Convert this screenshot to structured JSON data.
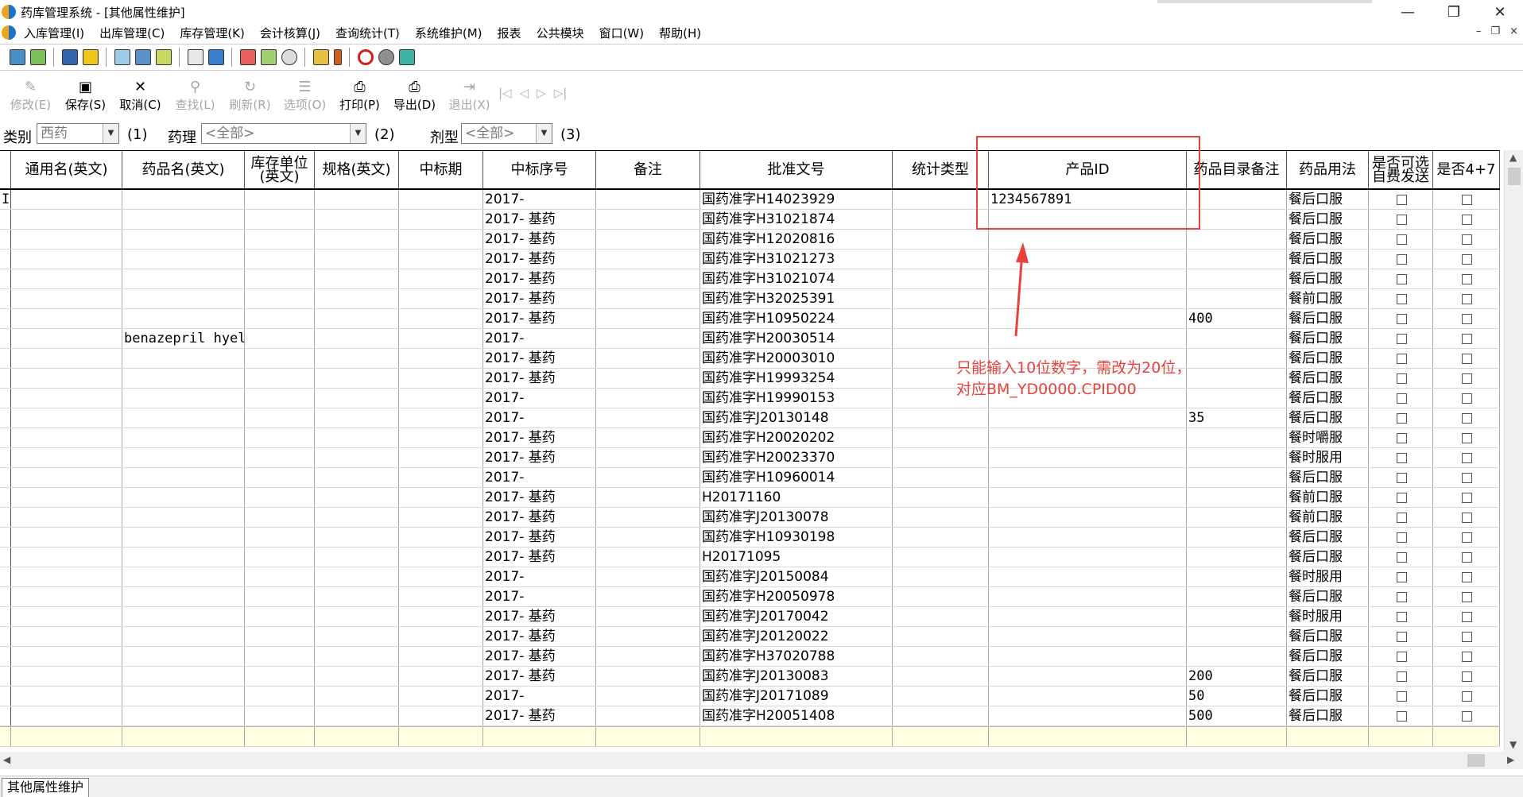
{
  "titlebar": {
    "title": "药库管理系统 - [其他属性维护]",
    "minimize": "—",
    "restore": "❐",
    "close": "✕"
  },
  "menu": {
    "items": [
      "入库管理(I)",
      "出库管理(C)",
      "库存管理(K)",
      "会计核算(J)",
      "查询统计(T)",
      "系统维护(M)",
      "报表",
      "公共模块",
      "窗口(W)",
      "帮助(H)"
    ],
    "mdi": [
      "–",
      "❐",
      "×"
    ]
  },
  "actions": [
    {
      "label": "修改(E)",
      "icon": "✎",
      "enabled": false
    },
    {
      "label": "保存(S)",
      "icon": "▣",
      "enabled": true
    },
    {
      "label": "取消(C)",
      "icon": "✕",
      "enabled": true
    },
    {
      "label": "查找(L)",
      "icon": "⚲",
      "enabled": false
    },
    {
      "label": "刷新(R)",
      "icon": "↻",
      "enabled": false
    },
    {
      "label": "选项(O)",
      "icon": "☰",
      "enabled": false
    },
    {
      "label": "打印(P)",
      "icon": "⎙",
      "enabled": true
    },
    {
      "label": "导出(D)",
      "icon": "⎙",
      "enabled": true
    },
    {
      "label": "退出(X)",
      "icon": "⇥",
      "enabled": false
    }
  ],
  "nav_arrows": [
    "|◁",
    "◁",
    "▷",
    "▷|"
  ],
  "filters": {
    "category_label": "类别",
    "category_value": "西药",
    "category_hint": "(1)",
    "pharm_label": "药理",
    "pharm_value": "<全部>",
    "pharm_hint": "(2)",
    "form_label": "剂型",
    "form_value": "<全部>",
    "form_hint": "(3)"
  },
  "grid": {
    "columns": [
      "通用名(英文)",
      "药品名(英文)",
      "库存单位\n(英文)",
      "规格(英文)",
      "中标期",
      "中标序号",
      "备注",
      "批准文号",
      "统计类型",
      "产品ID",
      "药品目录备注",
      "药品用法",
      "是否可选\n自费发送",
      "是否4+7"
    ],
    "rows": [
      {
        "drug_en": "",
        "bid_no": "2017-",
        "approval": "国药准字H14023929",
        "product_id": "1234567891",
        "catalog_note": "",
        "usage": "餐后口服"
      },
      {
        "drug_en": "",
        "bid_no": "2017- 基药",
        "approval": "国药准字H31021874",
        "product_id": "",
        "catalog_note": "",
        "usage": "餐后口服"
      },
      {
        "drug_en": "",
        "bid_no": "2017- 基药",
        "approval": "国药准字H12020816",
        "product_id": "",
        "catalog_note": "",
        "usage": "餐后口服"
      },
      {
        "drug_en": "",
        "bid_no": "2017- 基药",
        "approval": "国药准字H31021273",
        "product_id": "",
        "catalog_note": "",
        "usage": "餐后口服"
      },
      {
        "drug_en": "",
        "bid_no": "2017- 基药",
        "approval": "国药准字H31021074",
        "product_id": "",
        "catalog_note": "",
        "usage": "餐后口服"
      },
      {
        "drug_en": "",
        "bid_no": "2017- 基药",
        "approval": "国药准字H32025391",
        "product_id": "",
        "catalog_note": "",
        "usage": "餐前口服"
      },
      {
        "drug_en": "",
        "bid_no": "2017- 基药",
        "approval": "国药准字H10950224",
        "product_id": "",
        "catalog_note": "400",
        "usage": "餐后口服"
      },
      {
        "drug_en": "benazepril hyel",
        "bid_no": "2017-",
        "approval": "国药准字H20030514",
        "product_id": "",
        "catalog_note": "",
        "usage": "餐后口服"
      },
      {
        "drug_en": "",
        "bid_no": "2017- 基药",
        "approval": "国药准字H20003010",
        "product_id": "",
        "catalog_note": "",
        "usage": "餐后口服"
      },
      {
        "drug_en": "",
        "bid_no": "2017- 基药",
        "approval": "国药准字H19993254",
        "product_id": "",
        "catalog_note": "",
        "usage": "餐后口服"
      },
      {
        "drug_en": "",
        "bid_no": "2017-",
        "approval": "国药准字H19990153",
        "product_id": "",
        "catalog_note": "",
        "usage": "餐后口服"
      },
      {
        "drug_en": "",
        "bid_no": "2017-",
        "approval": "国药准字J20130148",
        "product_id": "",
        "catalog_note": "35",
        "usage": "餐后口服"
      },
      {
        "drug_en": "",
        "bid_no": "2017- 基药",
        "approval": "国药准字H20020202",
        "product_id": "",
        "catalog_note": "",
        "usage": "餐时嚼服"
      },
      {
        "drug_en": "",
        "bid_no": "2017- 基药",
        "approval": "国药准字H20023370",
        "product_id": "",
        "catalog_note": "",
        "usage": "餐时服用"
      },
      {
        "drug_en": "",
        "bid_no": "2017-",
        "approval": "国药准字H10960014",
        "product_id": "",
        "catalog_note": "",
        "usage": "餐后口服"
      },
      {
        "drug_en": "",
        "bid_no": "2017- 基药",
        "approval": "H20171160",
        "product_id": "",
        "catalog_note": "",
        "usage": "餐前口服"
      },
      {
        "drug_en": "",
        "bid_no": "2017- 基药",
        "approval": "国药准字J20130078",
        "product_id": "",
        "catalog_note": "",
        "usage": "餐前口服"
      },
      {
        "drug_en": "",
        "bid_no": "2017- 基药",
        "approval": "国药准字H10930198",
        "product_id": "",
        "catalog_note": "",
        "usage": "餐后口服"
      },
      {
        "drug_en": "",
        "bid_no": "2017- 基药",
        "approval": "H20171095",
        "product_id": "",
        "catalog_note": "",
        "usage": "餐后口服"
      },
      {
        "drug_en": "",
        "bid_no": "2017-",
        "approval": "国药准字J20150084",
        "product_id": "",
        "catalog_note": "",
        "usage": "餐时服用"
      },
      {
        "drug_en": "",
        "bid_no": "2017-",
        "approval": "国药准字H20050978",
        "product_id": "",
        "catalog_note": "",
        "usage": "餐后口服"
      },
      {
        "drug_en": "",
        "bid_no": "2017- 基药",
        "approval": "国药准字J20170042",
        "product_id": "",
        "catalog_note": "",
        "usage": "餐时服用"
      },
      {
        "drug_en": "",
        "bid_no": "2017- 基药",
        "approval": "国药准字J20120022",
        "product_id": "",
        "catalog_note": "",
        "usage": "餐后口服"
      },
      {
        "drug_en": "",
        "bid_no": "2017- 基药",
        "approval": "国药准字H37020788",
        "product_id": "",
        "catalog_note": "",
        "usage": "餐后口服"
      },
      {
        "drug_en": "",
        "bid_no": "2017- 基药",
        "approval": "国药准字J20130083",
        "product_id": "",
        "catalog_note": "200",
        "usage": "餐后口服"
      },
      {
        "drug_en": "",
        "bid_no": "2017-",
        "approval": "国药准字J20171089",
        "product_id": "",
        "catalog_note": "50",
        "usage": "餐后口服"
      },
      {
        "drug_en": "",
        "bid_no": "2017- 基药",
        "approval": "国药准字H20051408",
        "product_id": "",
        "catalog_note": "500",
        "usage": "餐后口服"
      }
    ]
  },
  "annotation": {
    "line1": "只能输入10位数字，需改为20位，",
    "line2": "对应BM_YD0000.CPID00",
    "color": "#e8413c"
  },
  "status": {
    "tab": "其他属性维护"
  }
}
